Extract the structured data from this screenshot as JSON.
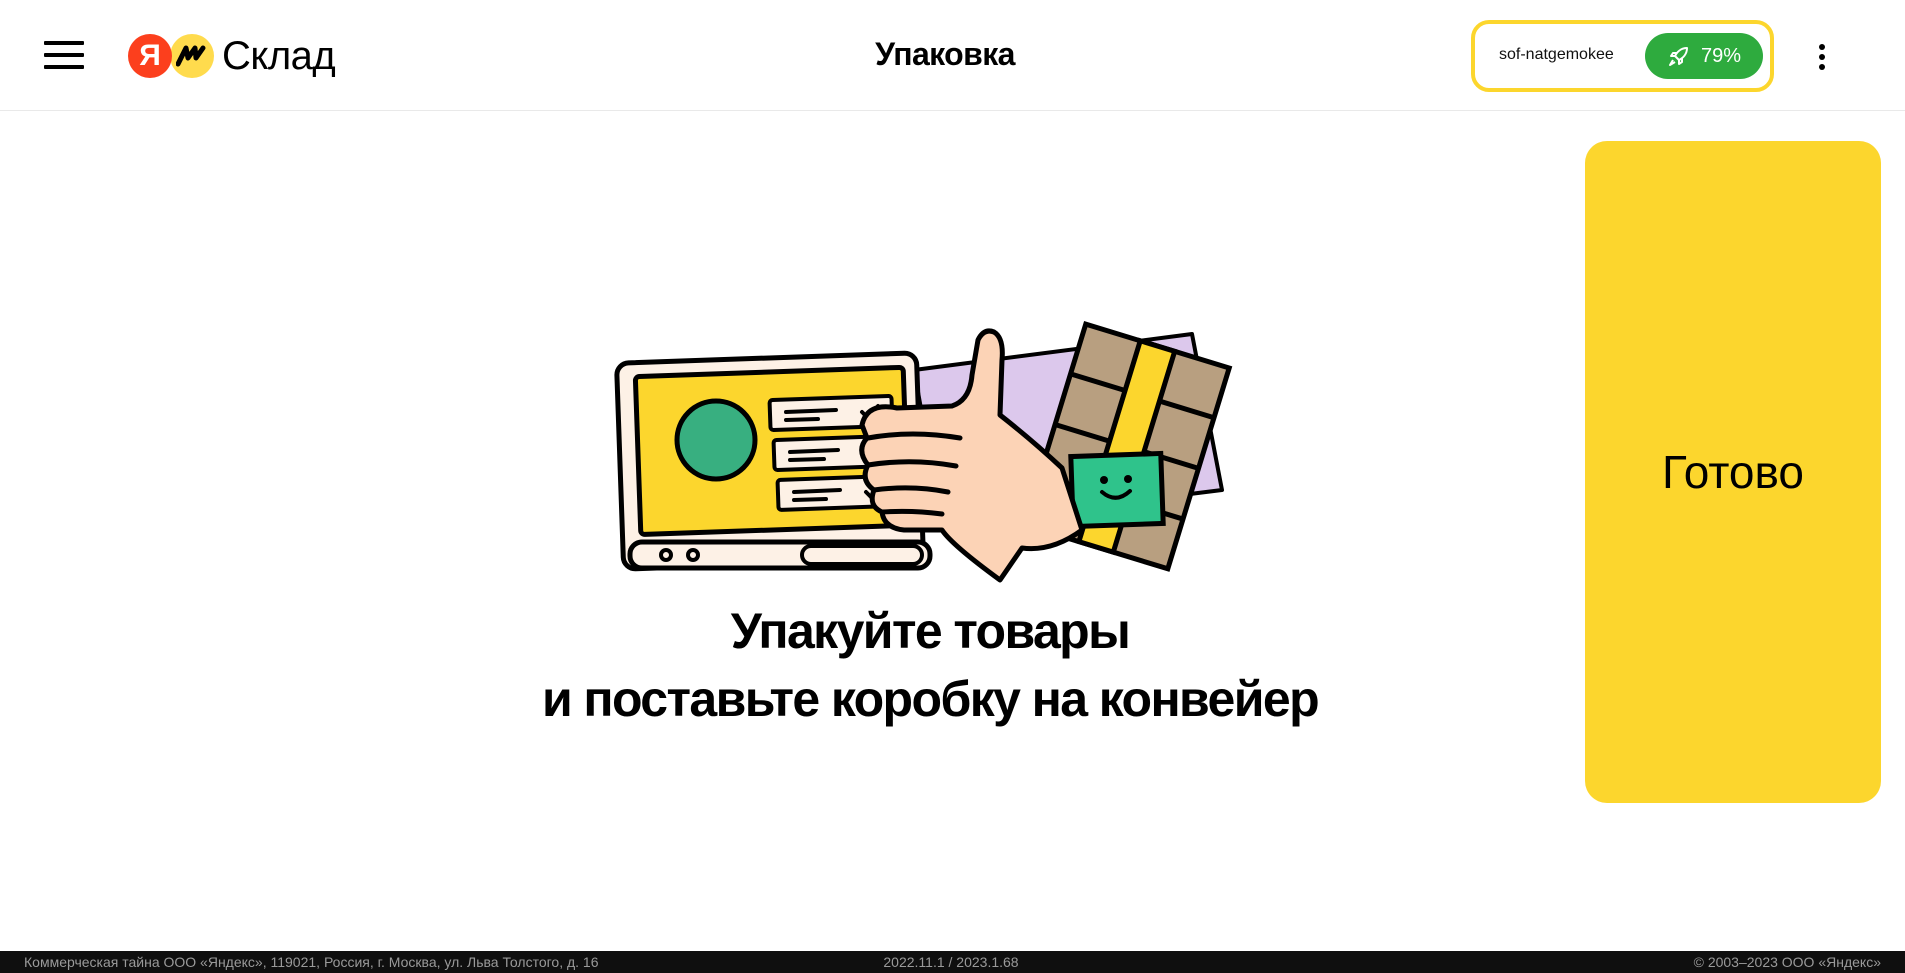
{
  "header": {
    "logo_ya": "Я",
    "logo_text": "Склад",
    "title": "Упаковка",
    "user": {
      "name": "sof-natgemokee",
      "performance": "79%",
      "performance_icon": "rocket-icon"
    },
    "menu_icon": "hamburger-menu-icon",
    "more_icon": "more-vertical-icon"
  },
  "main": {
    "message_line1": "Упакуйте товары",
    "message_line2": "и поставьте коробку на конвейер",
    "illustration": "thumbs-up-packing-illustration",
    "ready_button": "Готово"
  },
  "footer": {
    "left": "Коммерческая тайна ООО «Яндекс», 119021, Россия, г. Москва, ул. Льва Толстого, д. 16",
    "version": "2022.11.1 / 2023.1.68",
    "copyright": "© 2003–2023 ООО «Яндекс»"
  },
  "colors": {
    "accent_yellow": "#fcd62d",
    "success_green": "#2eab3e",
    "yandex_red": "#fc3f1d",
    "footer_bg": "#0f0f0f"
  }
}
